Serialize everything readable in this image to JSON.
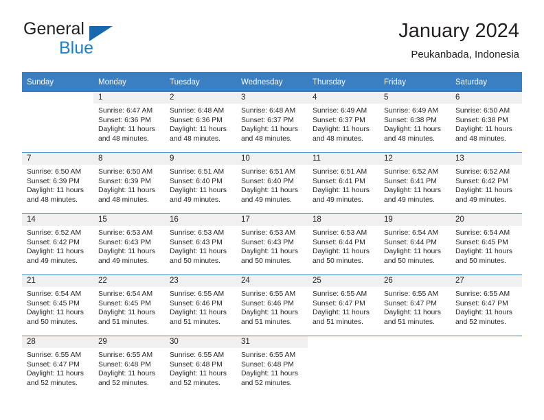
{
  "brand": {
    "name_top": "General",
    "name_bottom": "Blue",
    "accent_color": "#1f7fc4",
    "triangle_color": "#1868ad"
  },
  "header": {
    "title": "January 2024",
    "location": "Peukanbada, Indonesia",
    "header_bg": "#3a7fc1",
    "daynum_bg": "#f0f0f0"
  },
  "weekday_headers": [
    "Sunday",
    "Monday",
    "Tuesday",
    "Wednesday",
    "Thursday",
    "Friday",
    "Saturday"
  ],
  "weeks": [
    [
      {
        "day": "",
        "sunrise": "",
        "sunset": "",
        "daylight1": "",
        "daylight2": ""
      },
      {
        "day": "1",
        "sunrise": "Sunrise: 6:47 AM",
        "sunset": "Sunset: 6:36 PM",
        "daylight1": "Daylight: 11 hours",
        "daylight2": "and 48 minutes."
      },
      {
        "day": "2",
        "sunrise": "Sunrise: 6:48 AM",
        "sunset": "Sunset: 6:36 PM",
        "daylight1": "Daylight: 11 hours",
        "daylight2": "and 48 minutes."
      },
      {
        "day": "3",
        "sunrise": "Sunrise: 6:48 AM",
        "sunset": "Sunset: 6:37 PM",
        "daylight1": "Daylight: 11 hours",
        "daylight2": "and 48 minutes."
      },
      {
        "day": "4",
        "sunrise": "Sunrise: 6:49 AM",
        "sunset": "Sunset: 6:37 PM",
        "daylight1": "Daylight: 11 hours",
        "daylight2": "and 48 minutes."
      },
      {
        "day": "5",
        "sunrise": "Sunrise: 6:49 AM",
        "sunset": "Sunset: 6:38 PM",
        "daylight1": "Daylight: 11 hours",
        "daylight2": "and 48 minutes."
      },
      {
        "day": "6",
        "sunrise": "Sunrise: 6:50 AM",
        "sunset": "Sunset: 6:38 PM",
        "daylight1": "Daylight: 11 hours",
        "daylight2": "and 48 minutes."
      }
    ],
    [
      {
        "day": "7",
        "sunrise": "Sunrise: 6:50 AM",
        "sunset": "Sunset: 6:39 PM",
        "daylight1": "Daylight: 11 hours",
        "daylight2": "and 48 minutes."
      },
      {
        "day": "8",
        "sunrise": "Sunrise: 6:50 AM",
        "sunset": "Sunset: 6:39 PM",
        "daylight1": "Daylight: 11 hours",
        "daylight2": "and 48 minutes."
      },
      {
        "day": "9",
        "sunrise": "Sunrise: 6:51 AM",
        "sunset": "Sunset: 6:40 PM",
        "daylight1": "Daylight: 11 hours",
        "daylight2": "and 49 minutes."
      },
      {
        "day": "10",
        "sunrise": "Sunrise: 6:51 AM",
        "sunset": "Sunset: 6:40 PM",
        "daylight1": "Daylight: 11 hours",
        "daylight2": "and 49 minutes."
      },
      {
        "day": "11",
        "sunrise": "Sunrise: 6:51 AM",
        "sunset": "Sunset: 6:41 PM",
        "daylight1": "Daylight: 11 hours",
        "daylight2": "and 49 minutes."
      },
      {
        "day": "12",
        "sunrise": "Sunrise: 6:52 AM",
        "sunset": "Sunset: 6:41 PM",
        "daylight1": "Daylight: 11 hours",
        "daylight2": "and 49 minutes."
      },
      {
        "day": "13",
        "sunrise": "Sunrise: 6:52 AM",
        "sunset": "Sunset: 6:42 PM",
        "daylight1": "Daylight: 11 hours",
        "daylight2": "and 49 minutes."
      }
    ],
    [
      {
        "day": "14",
        "sunrise": "Sunrise: 6:52 AM",
        "sunset": "Sunset: 6:42 PM",
        "daylight1": "Daylight: 11 hours",
        "daylight2": "and 49 minutes."
      },
      {
        "day": "15",
        "sunrise": "Sunrise: 6:53 AM",
        "sunset": "Sunset: 6:43 PM",
        "daylight1": "Daylight: 11 hours",
        "daylight2": "and 49 minutes."
      },
      {
        "day": "16",
        "sunrise": "Sunrise: 6:53 AM",
        "sunset": "Sunset: 6:43 PM",
        "daylight1": "Daylight: 11 hours",
        "daylight2": "and 50 minutes."
      },
      {
        "day": "17",
        "sunrise": "Sunrise: 6:53 AM",
        "sunset": "Sunset: 6:43 PM",
        "daylight1": "Daylight: 11 hours",
        "daylight2": "and 50 minutes."
      },
      {
        "day": "18",
        "sunrise": "Sunrise: 6:53 AM",
        "sunset": "Sunset: 6:44 PM",
        "daylight1": "Daylight: 11 hours",
        "daylight2": "and 50 minutes."
      },
      {
        "day": "19",
        "sunrise": "Sunrise: 6:54 AM",
        "sunset": "Sunset: 6:44 PM",
        "daylight1": "Daylight: 11 hours",
        "daylight2": "and 50 minutes."
      },
      {
        "day": "20",
        "sunrise": "Sunrise: 6:54 AM",
        "sunset": "Sunset: 6:45 PM",
        "daylight1": "Daylight: 11 hours",
        "daylight2": "and 50 minutes."
      }
    ],
    [
      {
        "day": "21",
        "sunrise": "Sunrise: 6:54 AM",
        "sunset": "Sunset: 6:45 PM",
        "daylight1": "Daylight: 11 hours",
        "daylight2": "and 50 minutes."
      },
      {
        "day": "22",
        "sunrise": "Sunrise: 6:54 AM",
        "sunset": "Sunset: 6:45 PM",
        "daylight1": "Daylight: 11 hours",
        "daylight2": "and 51 minutes."
      },
      {
        "day": "23",
        "sunrise": "Sunrise: 6:55 AM",
        "sunset": "Sunset: 6:46 PM",
        "daylight1": "Daylight: 11 hours",
        "daylight2": "and 51 minutes."
      },
      {
        "day": "24",
        "sunrise": "Sunrise: 6:55 AM",
        "sunset": "Sunset: 6:46 PM",
        "daylight1": "Daylight: 11 hours",
        "daylight2": "and 51 minutes."
      },
      {
        "day": "25",
        "sunrise": "Sunrise: 6:55 AM",
        "sunset": "Sunset: 6:47 PM",
        "daylight1": "Daylight: 11 hours",
        "daylight2": "and 51 minutes."
      },
      {
        "day": "26",
        "sunrise": "Sunrise: 6:55 AM",
        "sunset": "Sunset: 6:47 PM",
        "daylight1": "Daylight: 11 hours",
        "daylight2": "and 51 minutes."
      },
      {
        "day": "27",
        "sunrise": "Sunrise: 6:55 AM",
        "sunset": "Sunset: 6:47 PM",
        "daylight1": "Daylight: 11 hours",
        "daylight2": "and 52 minutes."
      }
    ],
    [
      {
        "day": "28",
        "sunrise": "Sunrise: 6:55 AM",
        "sunset": "Sunset: 6:47 PM",
        "daylight1": "Daylight: 11 hours",
        "daylight2": "and 52 minutes."
      },
      {
        "day": "29",
        "sunrise": "Sunrise: 6:55 AM",
        "sunset": "Sunset: 6:48 PM",
        "daylight1": "Daylight: 11 hours",
        "daylight2": "and 52 minutes."
      },
      {
        "day": "30",
        "sunrise": "Sunrise: 6:55 AM",
        "sunset": "Sunset: 6:48 PM",
        "daylight1": "Daylight: 11 hours",
        "daylight2": "and 52 minutes."
      },
      {
        "day": "31",
        "sunrise": "Sunrise: 6:55 AM",
        "sunset": "Sunset: 6:48 PM",
        "daylight1": "Daylight: 11 hours",
        "daylight2": "and 52 minutes."
      },
      {
        "day": "",
        "sunrise": "",
        "sunset": "",
        "daylight1": "",
        "daylight2": ""
      },
      {
        "day": "",
        "sunrise": "",
        "sunset": "",
        "daylight1": "",
        "daylight2": ""
      },
      {
        "day": "",
        "sunrise": "",
        "sunset": "",
        "daylight1": "",
        "daylight2": ""
      }
    ]
  ]
}
